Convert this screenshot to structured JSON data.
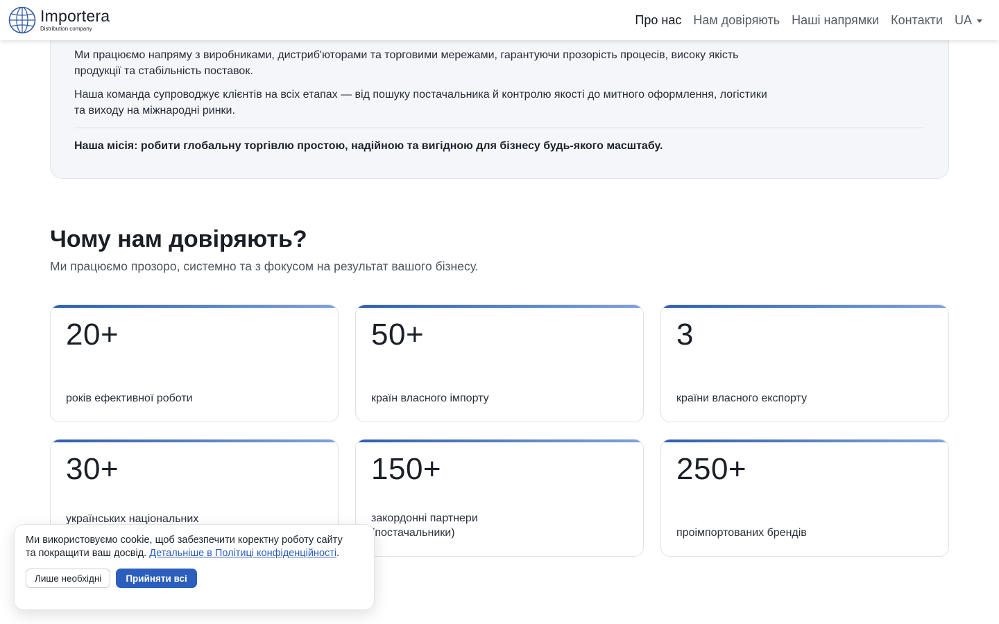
{
  "header": {
    "brand_name": "Importera",
    "brand_sub": "Distribution company",
    "logo_icon": "globe-icon",
    "nav": [
      {
        "label": "Про нас",
        "active": true
      },
      {
        "label": "Нам довіряють",
        "active": false
      },
      {
        "label": "Наші напрямки",
        "active": false
      },
      {
        "label": "Контакти",
        "active": false
      }
    ],
    "lang": "UA"
  },
  "about": {
    "p1": "Ми працюємо напряму з виробниками, дистриб'юторами та торговими мережами, гарантуючи прозорість процесів, високу якість продукції та стабільність поставок.",
    "p2": "Наша команда супроводжує клієнтів на всіх етапах — від пошуку постачальника й контролю якості до митного оформлення, логістики та виходу на міжнародні ринки.",
    "mission": "Наша місія: робити глобальну торгівлю простою, надійною та вигідною для бізнесу будь-якого масштабу."
  },
  "trust": {
    "title": "Чому нам довіряють?",
    "subtitle": "Ми працюємо прозоро, системно та з фокусом на результат вашого бізнесу.",
    "stats": [
      {
        "value": "20+",
        "label": "років ефективної роботи"
      },
      {
        "value": "50+",
        "label": "країн власного імпорту"
      },
      {
        "value": "3",
        "label": "країни власного експорту"
      },
      {
        "value": "30+",
        "label": "українських національних"
      },
      {
        "value": "150+",
        "label": "закордонні партнери (постачальники)"
      },
      {
        "value": "250+",
        "label": "проімпортованих брендів"
      }
    ]
  },
  "cookie": {
    "text": "Ми використовуємо cookie, щоб забезпечити коректну роботу сайту та покращити ваш досвід. ",
    "link": "Детальніше в Політиці конфіденційності",
    "end": ".",
    "btn_necessary": "Лише необхідні",
    "btn_accept": "Прийняти всі"
  },
  "colors": {
    "accent": "#2c5fbd",
    "card_bar_start": "#2f5fb0",
    "card_bar_end": "#7ea3db"
  }
}
